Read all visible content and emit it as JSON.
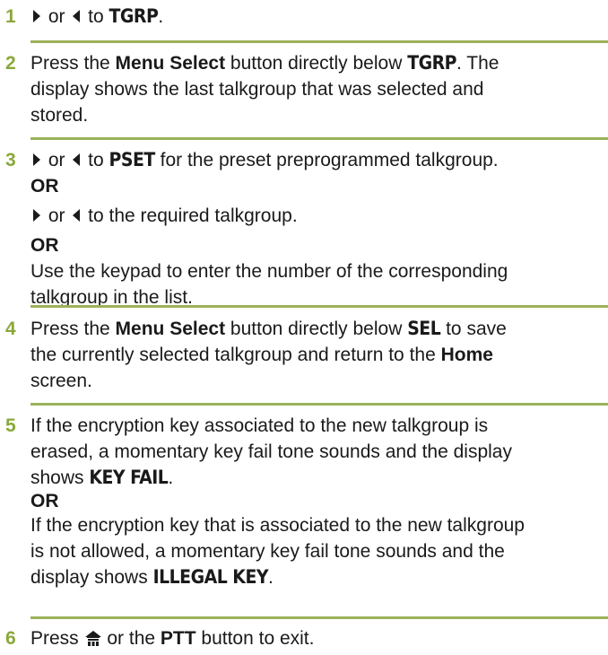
{
  "colors": {
    "step_number": "#8aa83a",
    "rule": "#9bb25a",
    "text": "#1a1a1a"
  },
  "icons": {
    "right": "right-arrow-icon",
    "left": "left-arrow-icon",
    "home": "home-icon"
  },
  "steps": [
    {
      "number": "1",
      "lines": [
        {
          "or": " or ",
          "to": " to ",
          "target": "TGRP",
          "end": "."
        }
      ]
    },
    {
      "number": "2",
      "pre": "Press the ",
      "bold": "Menu Select",
      "mid": " button directly below ",
      "display": "TGRP",
      "post": ". The",
      "line2": "display shows the last talkgroup that was selected and",
      "line3": "stored."
    },
    {
      "number": "3",
      "l1_or": " or ",
      "l1_to": " to ",
      "l1_display": "PSET",
      "l1_post": " for the preset preprogrammed talkgroup.",
      "or1": "OR",
      "l2_or": " or ",
      "l2_post": " to the required talkgroup.",
      "or2": "OR",
      "l3a": "Use the keypad to enter the number of the corresponding",
      "l3b": "talkgroup in the list."
    },
    {
      "number": "4",
      "pre": "Press the ",
      "bold": "Menu Select",
      "mid": " button directly below ",
      "display": "SEL",
      "post": " to save",
      "line2_pre": "the currently selected talkgroup and return to the ",
      "line2_bold": "Home",
      "line3": "screen."
    },
    {
      "number": "5",
      "a1": "If the encryption key associated to the new talkgroup is",
      "a2": "erased, a momentary key fail tone sounds and the display",
      "a3_pre": "shows ",
      "a3_display": "KEY FAIL",
      "a3_post": ".",
      "or": "OR",
      "b1": "If the encryption key that is associated to the new talkgroup",
      "b2": "is not allowed, a momentary key fail tone sounds and the",
      "b3_pre": "display shows ",
      "b3_display": "ILLEGAL KEY",
      "b3_post": "."
    },
    {
      "number": "6",
      "pre": "Press ",
      "mid": " or the ",
      "bold": "PTT",
      "post": " button to exit."
    }
  ]
}
